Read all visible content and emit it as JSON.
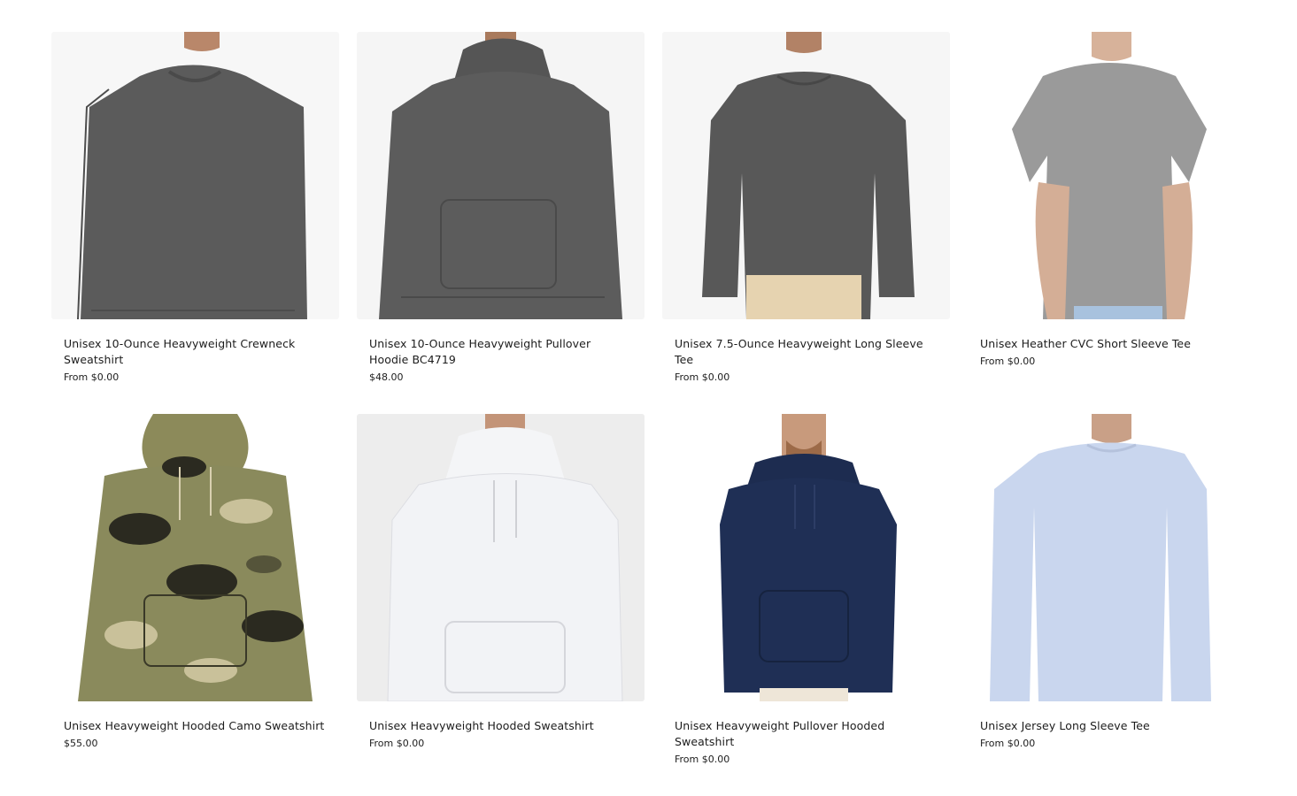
{
  "products": [
    {
      "title": "Unisex 10-Ounce Heavyweight Crewneck Sweatshirt",
      "price": "From $0.00",
      "image": "charcoal-crewneck-sweatshirt",
      "color": "#5b5b5b",
      "bg": "#f7f7f7"
    },
    {
      "title": "Unisex 10-Ounce Heavyweight Pullover Hoodie BC4719",
      "price": "$48.00",
      "image": "charcoal-pullover-hoodie",
      "color": "#5c5c5c",
      "bg": "#f5f5f5"
    },
    {
      "title": "Unisex 7.5-Ounce Heavyweight Long Sleeve Tee",
      "price": "From $0.00",
      "image": "charcoal-long-sleeve-tee",
      "color": "#585858",
      "bg": "#f6f6f6"
    },
    {
      "title": "Unisex Heather CVC Short Sleeve Tee",
      "price": "From $0.00",
      "image": "grey-heather-short-sleeve-tee",
      "color": "#9a9a9a",
      "bg": "#ffffff"
    },
    {
      "title": "Unisex Heavyweight Hooded Camo Sweatshirt",
      "price": "$55.00",
      "image": "camo-hooded-sweatshirt",
      "color": "#8a8a5c",
      "bg": "#ffffff"
    },
    {
      "title": "Unisex Heavyweight Hooded Sweatshirt",
      "price": "From $0.00",
      "image": "white-hooded-sweatshirt",
      "color": "#f2f3f6",
      "bg": "#ededed"
    },
    {
      "title": "Unisex Heavyweight Pullover Hooded Sweatshirt",
      "price": "From $0.00",
      "image": "navy-pullover-hooded-sweatshirt",
      "color": "#1f2f55",
      "bg": "#ffffff"
    },
    {
      "title": "Unisex Jersey Long Sleeve Tee",
      "price": "From $0.00",
      "image": "light-blue-long-sleeve-tee",
      "color": "#c9d6ee",
      "bg": "#ffffff"
    }
  ]
}
